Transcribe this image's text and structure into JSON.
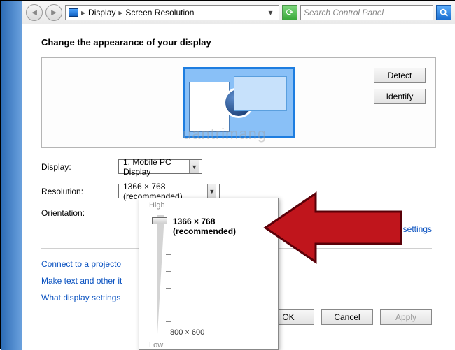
{
  "nav": {
    "crumb1": "Display",
    "crumb2": "Screen Resolution",
    "search_placeholder": "Search Control Panel"
  },
  "heading": "Change the appearance of your display",
  "display_number": "1",
  "buttons": {
    "detect": "Detect",
    "identify": "Identify",
    "ok": "OK",
    "cancel": "Cancel",
    "apply": "Apply"
  },
  "fields": {
    "display_label": "Display:",
    "display_value": "1. Mobile PC Display",
    "resolution_label": "Resolution:",
    "resolution_value": "1366 × 768 (recommended)",
    "orientation_label": "Orientation:"
  },
  "slider": {
    "high": "High",
    "low": "Low",
    "selected": "1366 × 768 (recommended)",
    "min": "800 × 600"
  },
  "links": {
    "advanced": "Advanced settings",
    "projector": "Connect to a projecto",
    "textsize": "Make text and other it",
    "help": "What display settings"
  },
  "watermark": "uantrimang"
}
